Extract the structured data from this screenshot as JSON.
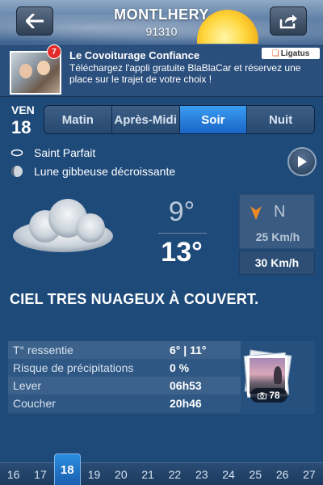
{
  "header": {
    "city": "MONTLHERY",
    "zip": "91310",
    "back_icon": "back-arrow-icon",
    "share_icon": "share-icon"
  },
  "ad": {
    "badge": "7",
    "title": "Le Covoiturage Confiance",
    "text": "Téléchargez l'appli gratuite BlaBlaCar et réservez une place sur le trajet de votre choix !",
    "provider": "Ligatus"
  },
  "day": {
    "name": "VEN",
    "number": "18"
  },
  "tabs": [
    {
      "label": "Matin"
    },
    {
      "label": "Après-Midi"
    },
    {
      "label": "Soir"
    },
    {
      "label": "Nuit"
    }
  ],
  "active_tab": "Soir",
  "saint": "Saint Parfait",
  "moon": "Lune gibbeuse décroissante",
  "weather": {
    "temp_min": "9°",
    "temp_max": "13°",
    "wind_direction": "N",
    "wind_speed": "25 Km/h",
    "gust_speed": "30 Km/h",
    "condition": "CIEL TRES NUAGEUX À COUVERT.",
    "icon": "cloud-icon"
  },
  "details": [
    {
      "label": "T° ressentie",
      "value": "6° | 11°"
    },
    {
      "label": "Risque de précipitations",
      "value": "0 %"
    },
    {
      "label": "Lever",
      "value": "06h53"
    },
    {
      "label": "Coucher",
      "value": "20h46"
    }
  ],
  "photos": {
    "count": "78",
    "icon": "camera-icon"
  },
  "days_strip": [
    "16",
    "17",
    "18",
    "19",
    "20",
    "21",
    "22",
    "23",
    "24",
    "25",
    "26",
    "27"
  ],
  "active_day": "18",
  "colors": {
    "background": "#1e4a7a",
    "active_tab": "#2a7fd9",
    "wind_arrow": "#f08a24"
  }
}
